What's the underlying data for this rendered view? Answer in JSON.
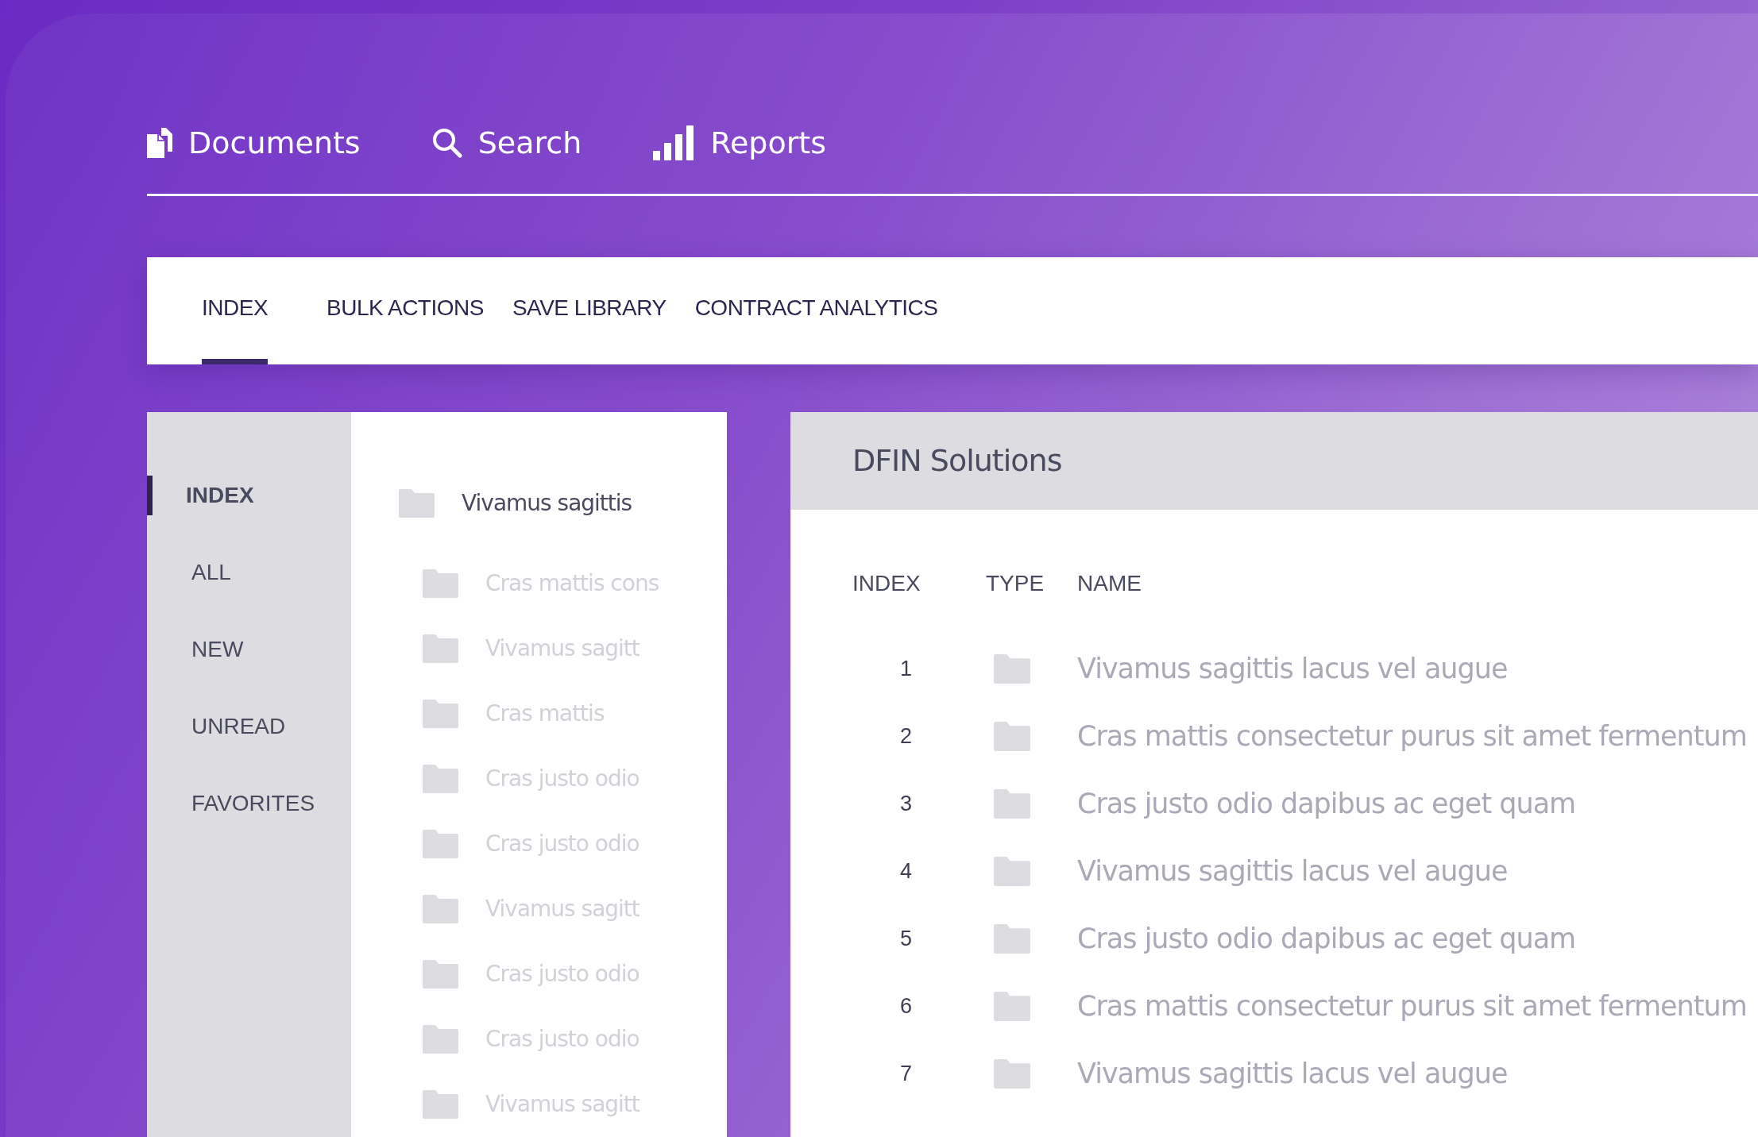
{
  "top_nav": [
    {
      "label": "Documents"
    },
    {
      "label": "Search"
    },
    {
      "label": "Reports"
    }
  ],
  "tabs": [
    {
      "label": "INDEX",
      "selected": true
    },
    {
      "label": "BULK ACTIONS",
      "selected": false
    },
    {
      "label": "SAVE LIBRARY",
      "selected": false
    },
    {
      "label": "CONTRACT ANALYTICS",
      "selected": false
    }
  ],
  "sidebar": {
    "items": [
      {
        "label": "INDEX",
        "selected": true
      },
      {
        "label": "ALL",
        "selected": false
      },
      {
        "label": "NEW",
        "selected": false
      },
      {
        "label": "UNREAD",
        "selected": false
      },
      {
        "label": "FAVORITES",
        "selected": false
      }
    ]
  },
  "folder_tree": [
    {
      "label": "Vivamus sagittis",
      "children": [
        {
          "label": "Cras mattis cons"
        },
        {
          "label": "Vivamus sagitt"
        },
        {
          "label": "Cras mattis"
        },
        {
          "label": "Cras justo odio"
        },
        {
          "label": "Cras justo odio"
        },
        {
          "label": "Vivamus sagitt"
        },
        {
          "label": "Cras justo odio"
        },
        {
          "label": "Cras justo odio"
        },
        {
          "label": "Vivamus sagitt"
        }
      ]
    }
  ],
  "content": {
    "title": "DFIN Solutions",
    "table": {
      "columns": [
        "INDEX",
        "TYPE",
        "NAME"
      ],
      "rows": [
        {
          "index": "1",
          "name": "Vivamus sagittis lacus vel augue"
        },
        {
          "index": "2",
          "name": "Cras mattis consectetur purus sit amet fermentum"
        },
        {
          "index": "3",
          "name": "Cras justo odio dapibus ac eget quam"
        },
        {
          "index": "4",
          "name": "Vivamus sagittis lacus vel augue"
        },
        {
          "index": "5",
          "name": "Cras justo odio dapibus ac eget quam"
        },
        {
          "index": "6",
          "name": "Cras mattis consectetur purus sit amet fermentum"
        },
        {
          "index": "7",
          "name": "Vivamus sagittis lacus vel augue"
        }
      ]
    }
  }
}
